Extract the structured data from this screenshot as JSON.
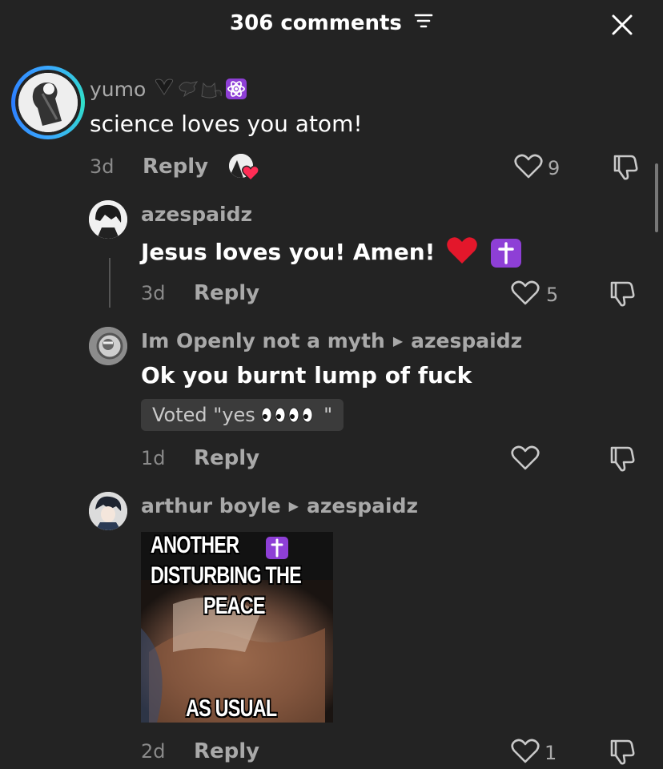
{
  "header": {
    "title": "306 comments"
  },
  "comments": [
    {
      "username": "yumo",
      "text": "science loves you atom!",
      "time": "3d",
      "reply_label": "Reply",
      "likes": "9"
    },
    {
      "username": "azespaidz",
      "text": "Jesus loves you! Amen!",
      "time": "3d",
      "reply_label": "Reply",
      "likes": "5"
    },
    {
      "username": "Im Openly not a myth",
      "reply_to": "azespaidz",
      "text": "Ok you burnt lump of fuck",
      "vote": "Voted \"yes",
      "vote_end": "\"",
      "time": "1d",
      "reply_label": "Reply",
      "likes": ""
    },
    {
      "username": "arthur boyle",
      "reply_to": "azespaidz",
      "meme_lines": [
        "ANOTHER",
        "DISTURBING THE",
        "PEACE",
        "AS USUAL"
      ],
      "time": "2d",
      "reply_label": "Reply",
      "likes": "1"
    }
  ],
  "colors": {
    "background": "#232323",
    "heart_red": "#ff2d55",
    "cross_purple": "#8e3fd6"
  }
}
